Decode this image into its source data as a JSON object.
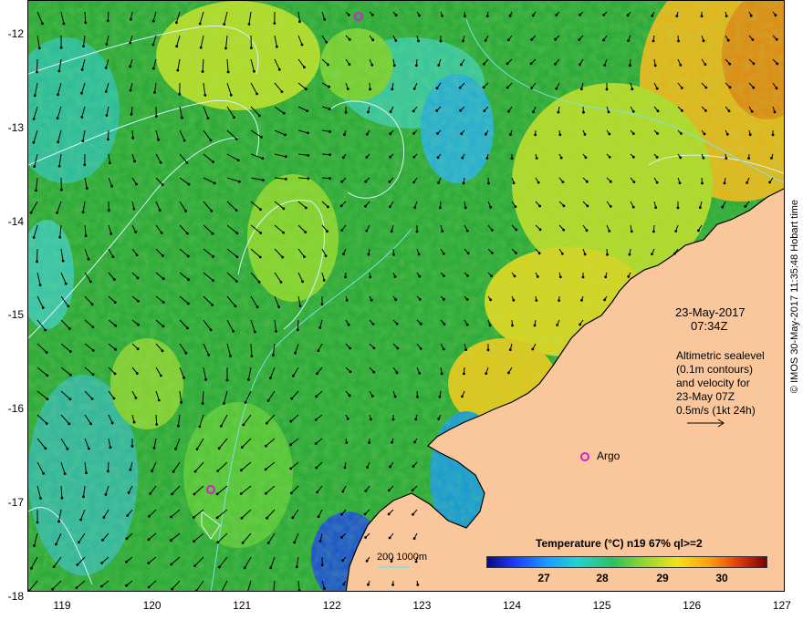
{
  "map": {
    "lat_labels": [
      "-12",
      "-13",
      "-14",
      "-15",
      "-16",
      "-17",
      "-18"
    ],
    "lon_labels": [
      "119",
      "120",
      "121",
      "122",
      "123",
      "124",
      "125",
      "126",
      "127"
    ],
    "colors": {
      "land": "#f9c79b",
      "ocean_base": "#2faa3a",
      "contour": "#d8f4ff",
      "depth": "#7fe0e6",
      "argo": "#d020d0",
      "arrow": "#000000"
    }
  },
  "annotations": {
    "date": "23-May-2017",
    "time": "07:34Z",
    "desc_lines": [
      "Altimetric sealevel",
      "(0.1m contours)",
      "and velocity for",
      "23-May 07Z"
    ],
    "scale_label": "0.5m/s (1kt 24h)",
    "argo": "Argo",
    "depth_label": "200  1000m"
  },
  "legend": {
    "title": "Temperature (°C) n19 67% ql>=2",
    "ticks": [
      "27",
      "28",
      "29",
      "30"
    ]
  },
  "credit": "© IMOS 30-May-2017 11:35:48 Hobart time"
}
